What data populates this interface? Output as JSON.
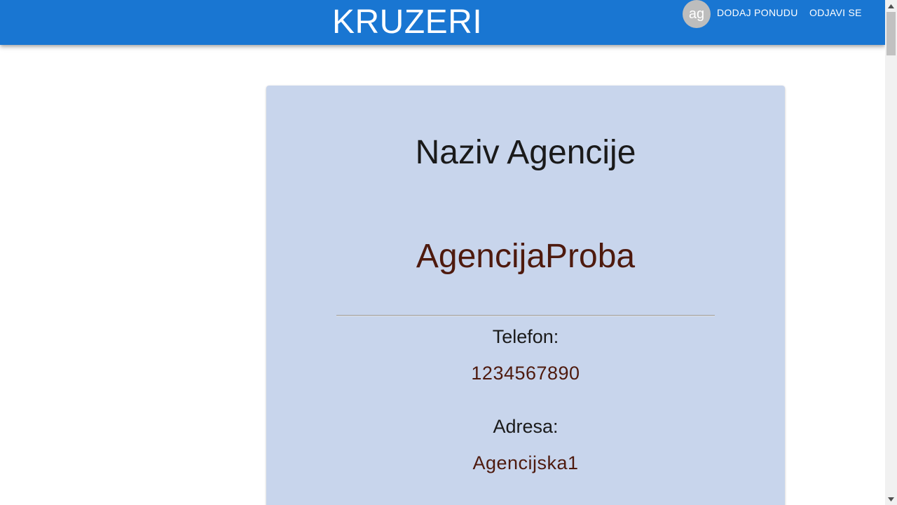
{
  "appbar": {
    "brand": "KRUZERI",
    "avatar_initials": "ag",
    "add_offer_label": "DODAJ PONUDU",
    "logout_label": "ODJAVI SE",
    "color": "#1976d2"
  },
  "card": {
    "title": "Naziv Agencije",
    "agency_name": "AgencijaProba",
    "phone_label": "Telefon:",
    "phone_value": "1234567890",
    "address_label": "Adresa:",
    "address_value": "Agencijska1",
    "background": "#c8d5ec",
    "value_color": "#4e1a0e"
  },
  "scrollbar": {
    "up_icon": "triangle-up-icon",
    "down_icon": "triangle-down-icon"
  }
}
